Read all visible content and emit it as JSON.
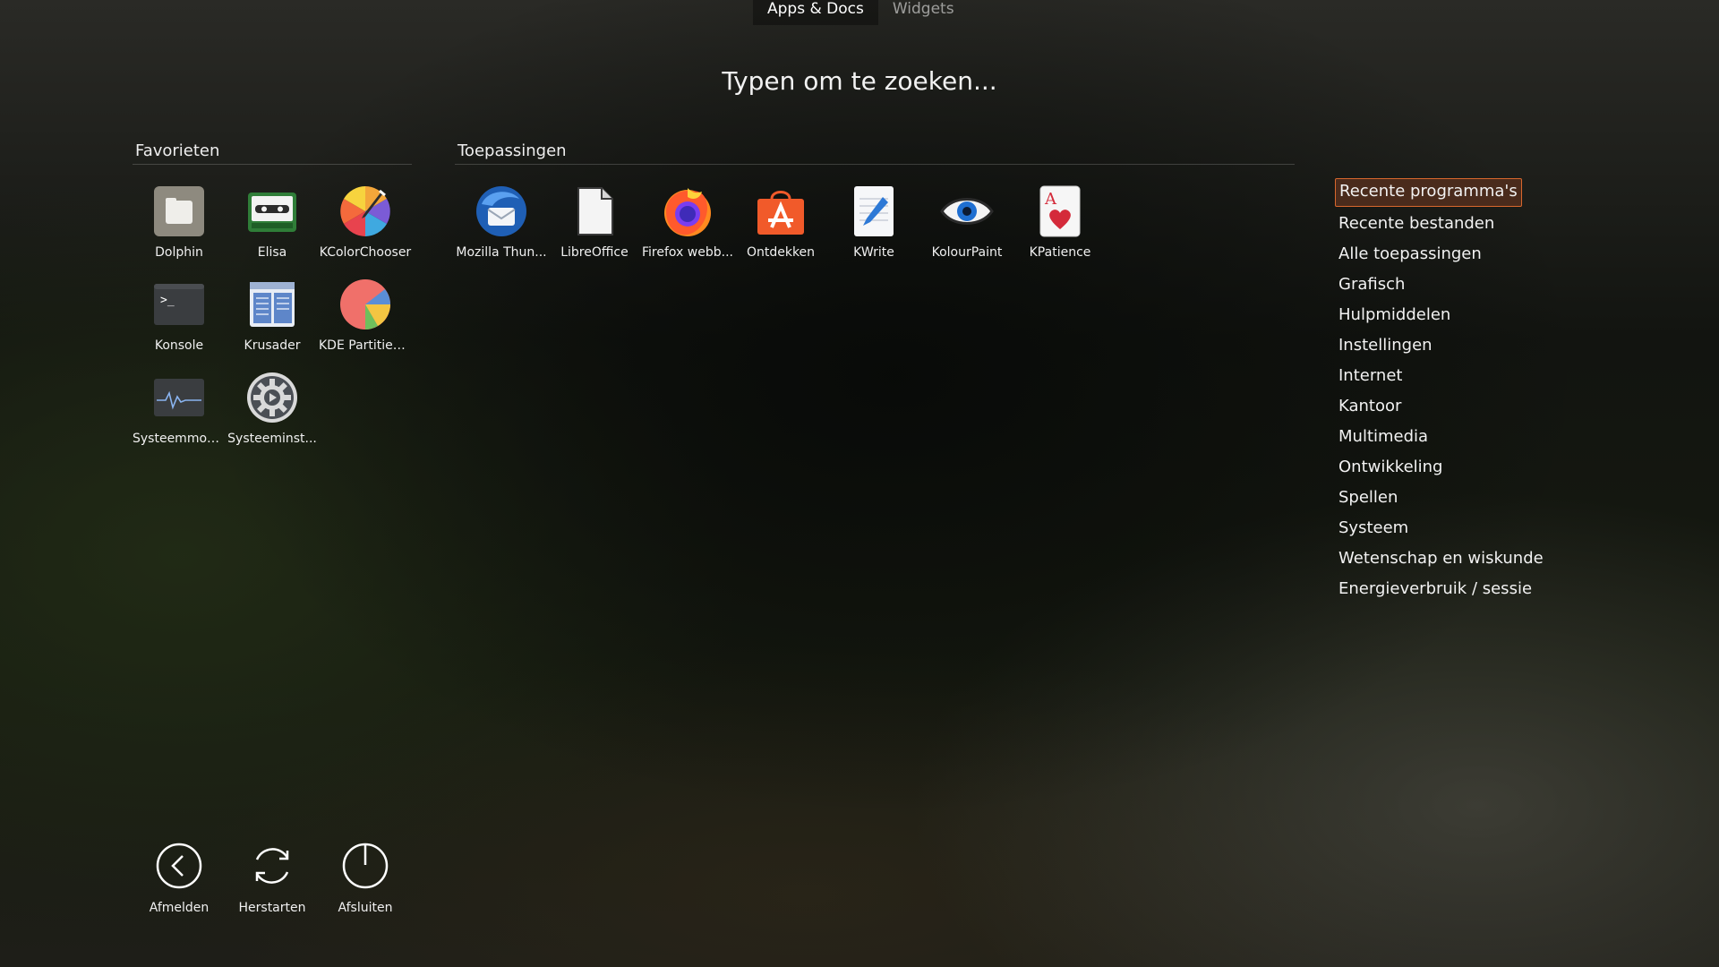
{
  "tabs": [
    {
      "label": "Apps & Docs",
      "active": true
    },
    {
      "label": "Widgets",
      "active": false
    }
  ],
  "search": {
    "prompt": "Typen om te zoeken..."
  },
  "favorites": {
    "title": "Favorieten",
    "items": [
      {
        "label": "Dolphin",
        "icon": "folder-icon"
      },
      {
        "label": "Elisa",
        "icon": "music-player-icon"
      },
      {
        "label": "KColorChooser",
        "icon": "color-wheel-icon"
      },
      {
        "label": "Konsole",
        "icon": "terminal-icon"
      },
      {
        "label": "Krusader",
        "icon": "file-manager-icon"
      },
      {
        "label": "KDE Partitieb...",
        "icon": "partition-pie-icon"
      },
      {
        "label": "Systeemmon...",
        "icon": "system-monitor-icon"
      },
      {
        "label": "Systeeminst...",
        "icon": "system-settings-gear-icon"
      }
    ]
  },
  "applications": {
    "title": "Toepassingen",
    "items": [
      {
        "label": "Mozilla Thun...",
        "icon": "thunderbird-icon"
      },
      {
        "label": "LibreOffice",
        "icon": "libreoffice-icon"
      },
      {
        "label": "Firefox webb...",
        "icon": "firefox-icon"
      },
      {
        "label": "Ontdekken",
        "icon": "discover-store-icon"
      },
      {
        "label": "KWrite",
        "icon": "kwrite-pencil-icon"
      },
      {
        "label": "KolourPaint",
        "icon": "kolourpaint-eye-icon"
      },
      {
        "label": "KPatience",
        "icon": "playing-card-icon"
      }
    ]
  },
  "categories": [
    {
      "label": "Recente programma's",
      "active": true
    },
    {
      "label": "Recente bestanden"
    },
    {
      "label": "Alle toepassingen"
    },
    {
      "label": "Grafisch"
    },
    {
      "label": "Hulpmiddelen"
    },
    {
      "label": "Instellingen"
    },
    {
      "label": "Internet"
    },
    {
      "label": "Kantoor"
    },
    {
      "label": "Multimedia"
    },
    {
      "label": "Ontwikkeling"
    },
    {
      "label": "Spellen"
    },
    {
      "label": "Systeem"
    },
    {
      "label": "Wetenschap en wiskunde"
    },
    {
      "label": "Energieverbruik / sessie"
    }
  ],
  "power": [
    {
      "label": "Afmelden",
      "icon": "logout-icon"
    },
    {
      "label": "Herstarten",
      "icon": "restart-icon"
    },
    {
      "label": "Afsluiten",
      "icon": "shutdown-icon"
    }
  ],
  "colors": {
    "accent": "#d8672d",
    "accent_bg": "#4a2b1c",
    "text": "#ffffff"
  }
}
